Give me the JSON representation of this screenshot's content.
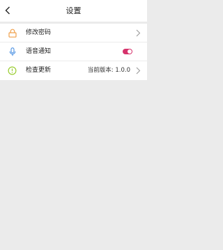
{
  "header": {
    "title": "设置"
  },
  "settings": {
    "items": [
      {
        "label": "修改密码",
        "icon": "lock-icon"
      },
      {
        "label": "语音通知",
        "icon": "microphone-icon",
        "toggle_on": true
      },
      {
        "label": "检查更新",
        "icon": "update-icon",
        "value": "当前版本: 1.0.0"
      }
    ]
  },
  "colors": {
    "accent_orange": "#f0a04b",
    "accent_blue": "#4a90e2",
    "accent_green": "#9acd32",
    "toggle_on": "#d6336c"
  }
}
